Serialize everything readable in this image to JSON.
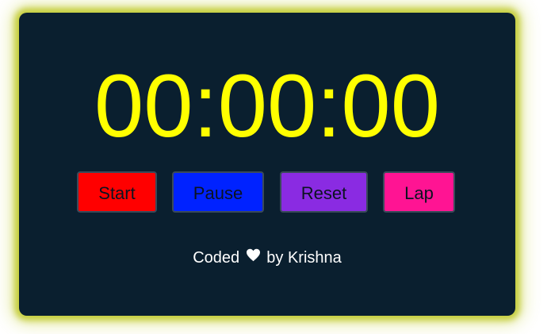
{
  "stopwatch": {
    "display": "00:00:00"
  },
  "buttons": {
    "start": "Start",
    "pause": "Pause",
    "reset": "Reset",
    "lap": "Lap"
  },
  "credit": {
    "prefix": "Coded",
    "icon": "heart-icon",
    "suffix": "by Krishna"
  },
  "colors": {
    "display": "#ffff00",
    "card_background": "#0a1f2f",
    "glow": "#c8d23c",
    "start": "#ff0000",
    "pause": "#0022ff",
    "reset": "#8a2be2",
    "lap": "#ff1493"
  }
}
